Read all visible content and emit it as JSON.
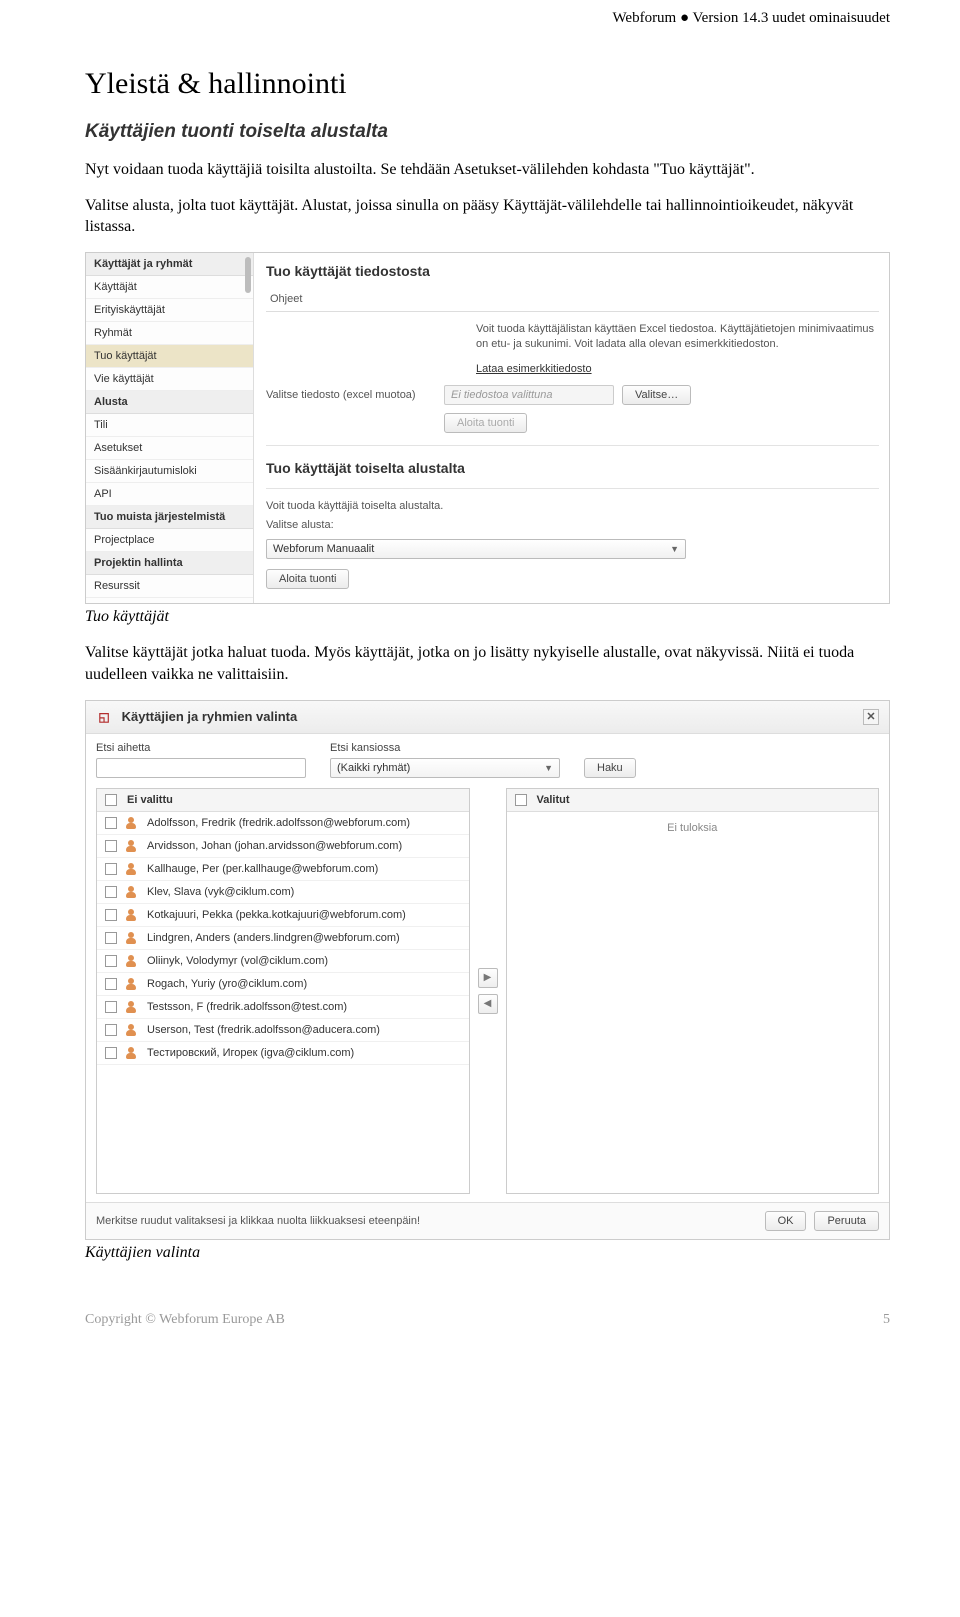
{
  "header_right": "Webforum ● Version 14.3 uudet ominaisuudet",
  "h1": "Yleistä & hallinnointi",
  "h2": "Käyttäjien tuonti toiselta alustalta",
  "para1": "Nyt voidaan tuoda käyttäjiä toisilta alustoilta. Se tehdään Asetukset-välilehden kohdasta \"Tuo käyttäjät\".",
  "para2": "Valitse alusta, jolta tuot käyttäjät. Alustat, joissa sinulla on pääsy Käyttäjät-välilehdelle tai hallinnointioikeudet, näkyvät listassa.",
  "caption1": "Tuo käyttäjät",
  "para3": "Valitse käyttäjät jotka haluat tuoda. Myös käyttäjät, jotka on jo lisätty nykyiselle alustalle, ovat näkyvissä. Niitä ei tuoda uudelleen vaikka ne valittaisiin.",
  "caption2": "Käyttäjien valinta",
  "footer_left": "Copyright © Webforum Europe AB",
  "footer_right": "5",
  "app": {
    "sidebar": {
      "group1": "Käyttäjät ja ryhmät",
      "items1": [
        "Käyttäjät",
        "Erityiskäyttäjät",
        "Ryhmät",
        "Tuo käyttäjät",
        "Vie käyttäjät"
      ],
      "group2": "Alusta",
      "items2": [
        "Tili",
        "Asetukset",
        "Sisäänkirjautumisloki",
        "API"
      ],
      "group3": "Tuo muista järjestelmistä",
      "items3": [
        "Projectplace"
      ],
      "group4": "Projektin hallinta",
      "items4": [
        "Resurssit"
      ]
    },
    "section1_title": "Tuo käyttäjät tiedostosta",
    "tab_help": "Ohjeet",
    "help_text": "Voit tuoda käyttäjälistan käyttäen Excel tiedostoa. Käyttäjätietojen minimivaatimus on etu- ja sukunimi. Voit ladata alla olevan esimerkkitiedoston.",
    "link_sample": "Lataa esimerkkitiedosto",
    "row_file_label": "Valitse tiedosto (excel muotoa)",
    "row_file_placeholder": "Ei tiedostoa valittuna",
    "btn_browse": "Valitse…",
    "btn_start1": "Aloita tuonti",
    "section2_title": "Tuo käyttäjät toiselta alustalta",
    "help_text2a": "Voit tuoda käyttäjiä toiselta alustalta.",
    "help_text2b": "Valitse alusta:",
    "select_value": "Webforum Manuaalit",
    "btn_start2": "Aloita tuonti"
  },
  "dialog": {
    "title": "Käyttäjien ja ryhmien valinta",
    "search_subject_label": "Etsi aihetta",
    "search_folder_label": "Etsi kansiossa",
    "search_folder_value": "(Kaikki ryhmät)",
    "btn_search": "Haku",
    "left_header": "Ei valittu",
    "right_header": "Valitut",
    "right_empty": "Ei tuloksia",
    "users": [
      "Adolfsson, Fredrik (fredrik.adolfsson@webforum.com)",
      "Arvidsson, Johan (johan.arvidsson@webforum.com)",
      "Kallhauge, Per (per.kallhauge@webforum.com)",
      "Klev, Slava (vyk@ciklum.com)",
      "Kotkajuuri, Pekka (pekka.kotkajuuri@webforum.com)",
      "Lindgren, Anders (anders.lindgren@webforum.com)",
      "Oliinyk, Volodymyr (vol@ciklum.com)",
      "Rogach, Yuriy (yro@ciklum.com)",
      "Testsson, F (fredrik.adolfsson@test.com)",
      "Userson, Test (fredrik.adolfsson@aducera.com)",
      "Тестировский, Игорек (igva@ciklum.com)"
    ],
    "footer_hint": "Merkitse ruudut valitaksesi ja klikkaa nuolta liikkuaksesi eteenpäin!",
    "btn_ok": "OK",
    "btn_cancel": "Peruuta"
  }
}
